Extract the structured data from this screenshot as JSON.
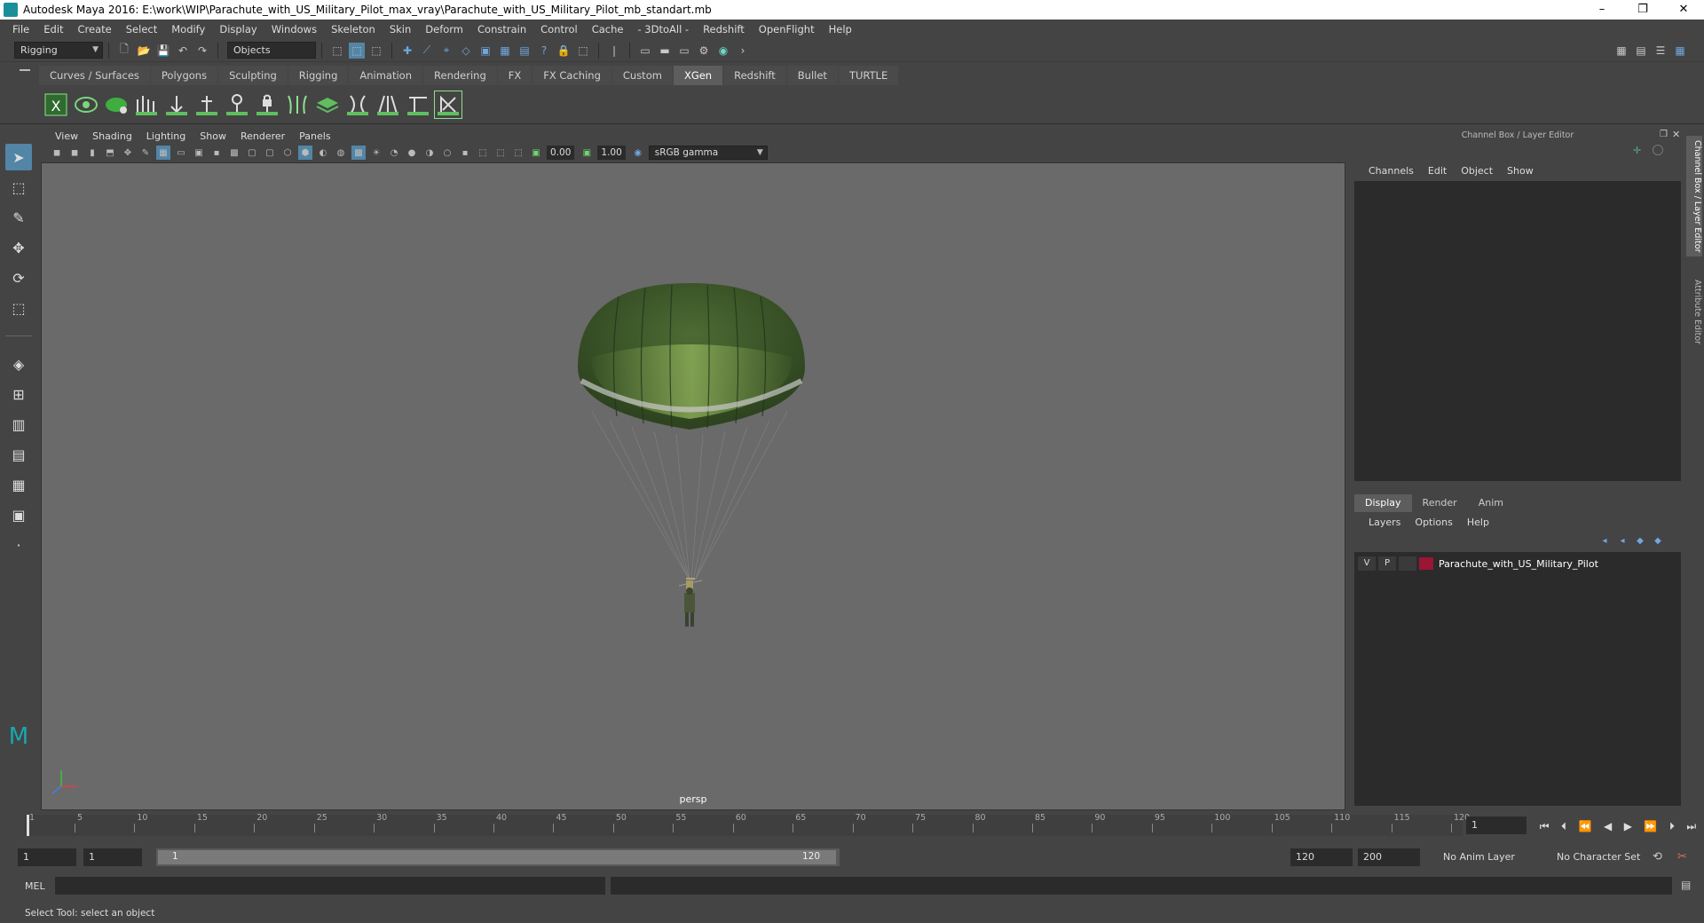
{
  "window": {
    "title": "Autodesk Maya 2016: E:\\work\\WIP\\Parachute_with_US_Military_Pilot_max_vray\\Parachute_with_US_Military_Pilot_mb_standart.mb",
    "minimize": "–",
    "restore": "❐",
    "close": "✕"
  },
  "menubar": [
    "File",
    "Edit",
    "Create",
    "Select",
    "Modify",
    "Display",
    "Windows",
    "Skeleton",
    "Skin",
    "Deform",
    "Constrain",
    "Control",
    "Cache",
    "- 3DtoAll -",
    "Redshift",
    "OpenFlight",
    "Help"
  ],
  "statusline": {
    "menuset": "Rigging",
    "selection_mode": "Objects"
  },
  "shelf_tabs": [
    {
      "label": "Curves / Surfaces",
      "active": false
    },
    {
      "label": "Polygons",
      "active": false
    },
    {
      "label": "Sculpting",
      "active": false
    },
    {
      "label": "Rigging",
      "active": false
    },
    {
      "label": "Animation",
      "active": false
    },
    {
      "label": "Rendering",
      "active": false
    },
    {
      "label": "FX",
      "active": false
    },
    {
      "label": "FX Caching",
      "active": false
    },
    {
      "label": "Custom",
      "active": false
    },
    {
      "label": "XGen",
      "active": true
    },
    {
      "label": "Redshift",
      "active": false
    },
    {
      "label": "Bullet",
      "active": false
    },
    {
      "label": "TURTLE",
      "active": false
    }
  ],
  "viewport": {
    "menu": [
      "View",
      "Shading",
      "Lighting",
      "Show",
      "Renderer",
      "Panels"
    ],
    "exposure": "0.00",
    "gamma": "1.00",
    "color_space": "sRGB gamma",
    "camera_label": "persp"
  },
  "channel_box": {
    "header": "Channel Box / Layer Editor",
    "menu": [
      "Channels",
      "Edit",
      "Object",
      "Show"
    ]
  },
  "layer_editor": {
    "tabs": [
      {
        "label": "Display",
        "active": true
      },
      {
        "label": "Render",
        "active": false
      },
      {
        "label": "Anim",
        "active": false
      }
    ],
    "menu": [
      "Layers",
      "Options",
      "Help"
    ],
    "layers": [
      {
        "visible": "V",
        "playback": "P",
        "name": "Parachute_with_US_Military_Pilot",
        "color": "#9b1535"
      }
    ]
  },
  "side_tabs": {
    "channel_box": "Channel Box / Layer Editor",
    "attribute_editor": "Attribute Editor"
  },
  "timeline": {
    "ticks": [
      1,
      5,
      10,
      15,
      20,
      25,
      30,
      35,
      40,
      45,
      50,
      55,
      60,
      65,
      70,
      75,
      80,
      85,
      90,
      95,
      100,
      105,
      110,
      115,
      120
    ],
    "current_frame": "1"
  },
  "range": {
    "start": "1",
    "playback_start": "1",
    "slider_start": "1",
    "slider_end": "120",
    "playback_end": "120",
    "end": "200",
    "anim_layer": "No Anim Layer",
    "character_set": "No Character Set"
  },
  "command_line": {
    "mode": "MEL"
  },
  "status": {
    "message": "Select Tool: select an object"
  },
  "colors": {
    "accent": "#5285a6",
    "canopy": "#3f5a2a",
    "viewport_bg": "#6a6a6a"
  }
}
